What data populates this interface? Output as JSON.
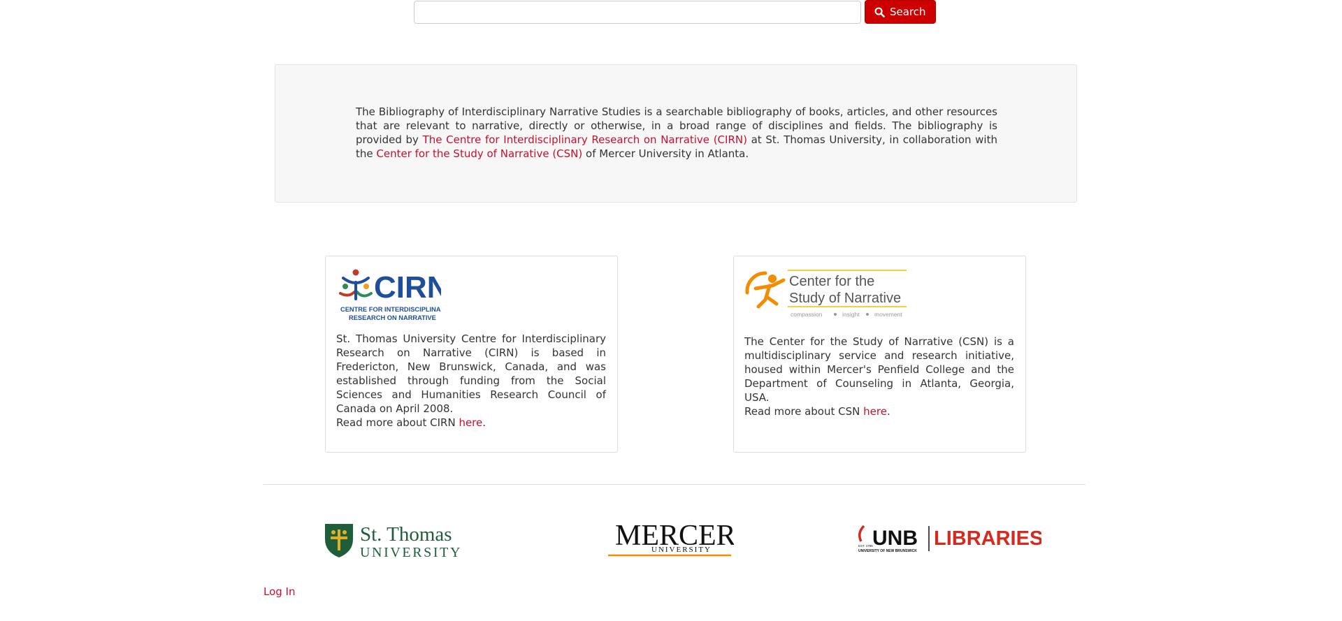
{
  "search": {
    "value": "",
    "placeholder": "",
    "button_label": "Search",
    "button_icon": "search-icon"
  },
  "intro": {
    "text_before_cirn": "The Bibliography of Interdisciplinary Narrative Studies is a searchable bibliography of books, articles, and other resources that are relevant to narrative, directly or otherwise, in a broad range of disciplines and fields. The bibliography is provided by ",
    "cirn_link": "The Centre for Interdisciplinary Research on Narrative (CIRN)",
    "text_middle": " at St. Thomas University, in collaboration with the ",
    "csn_link": "Center for the Study of Narrative (CSN)",
    "text_after": " of Mercer University in Atlanta."
  },
  "cirn_card": {
    "logo_title": "CIRN",
    "logo_subtitle_1": "CENTRE FOR INTERDISCIPLINARY",
    "logo_subtitle_2": "RESEARCH ON NARRATIVE",
    "description": "St. Thomas University Centre for Interdisciplinary Research on Narrative (CIRN) is based in Fredericton, New Brunswick, Canada, and was established through funding from the Social Sciences and Humanities Research Council of Canada on April 2008.",
    "read_more_prefix": "Read more about CIRN ",
    "read_more_link": "here",
    "read_more_suffix": "."
  },
  "csn_card": {
    "logo_line_1": "Center for the",
    "logo_line_2": "Study of Narrative",
    "logo_tag_1": "compassion",
    "logo_tag_2": "insight",
    "logo_tag_3": "movement",
    "description": "The Center for the Study of Narrative (CSN) is a multidisciplinary service and research initiative, housed within Mercer's Penfield College and the Department of Counseling in Atlanta, Georgia, USA.",
    "read_more_prefix": "Read more about CSN ",
    "read_more_link": "here",
    "read_more_suffix": "."
  },
  "partners": {
    "stu_line_1": "St. Thomas",
    "stu_line_2": "UNIVERSITY",
    "mercer_line_1": "MERCER",
    "mercer_line_2": "UNIVERSITY",
    "unb_est": "EST. 1785",
    "unb_name": "UNB",
    "unb_sub": "UNIVERSITY OF NEW BRUNSWICK",
    "unb_libraries": "LIBRARIES"
  },
  "footer": {
    "login_label": "Log In"
  },
  "colors": {
    "link": "#c8102e",
    "button": "#cc0000",
    "well_bg": "#f7f7f7",
    "cirn_blue": "#1f4e9a",
    "csn_orange": "#f28c00",
    "stu_green": "#1f5e3b",
    "unb_red": "#d52b1e"
  }
}
